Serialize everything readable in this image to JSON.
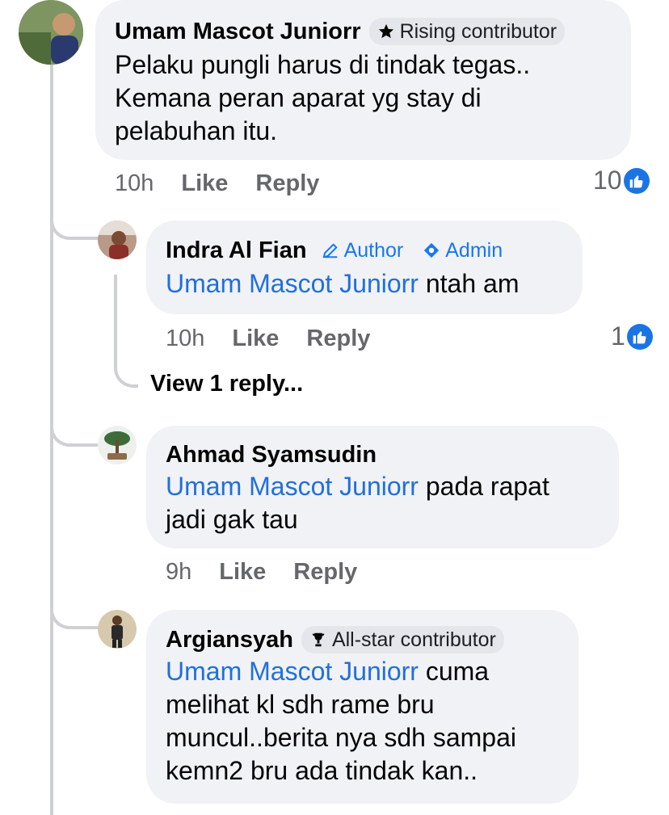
{
  "colors": {
    "mention": "#216fdb",
    "bubble": "#f0f2f5",
    "like_blue": "#1b74e4",
    "meta": "#65676b"
  },
  "comments": [
    {
      "name": "Umam Mascot Juniorr",
      "badge": {
        "icon": "star-icon",
        "label": "Rising contributor"
      },
      "lines": [
        "Pelaku pungli harus di tindak tegas..",
        "Kemana peran aparat yg stay di",
        "pelabuhan itu."
      ],
      "time": "10h",
      "like": "Like",
      "reply": "Reply",
      "reaction_count": "10"
    },
    {
      "name": "Indra Al Fian",
      "badges": [
        {
          "icon": "pencil-icon",
          "label": "Author"
        },
        {
          "icon": "admin-diamond-icon",
          "label": "Admin"
        }
      ],
      "mention": "Umam Mascot Juniorr",
      "text": " ntah am",
      "time": "10h",
      "like": "Like",
      "reply": "Reply",
      "reaction_count": "1",
      "view_replies": "View 1 reply..."
    },
    {
      "name": "Ahmad Syamsudin",
      "mention": "Umam Mascot Juniorr",
      "text_l1": " pada rapat",
      "text_l2": "jadi gak tau",
      "time": "9h",
      "like": "Like",
      "reply": "Reply"
    },
    {
      "name": "Argiansyah",
      "badge": {
        "icon": "trophy-icon",
        "label": "All-star contributor"
      },
      "mention": "Umam Mascot Juniorr",
      "text_l1": " cuma",
      "lines": [
        "melihat kl sdh rame bru",
        "muncul..berita nya sdh sampai",
        "kemn2 bru ada tindak kan.."
      ]
    }
  ]
}
